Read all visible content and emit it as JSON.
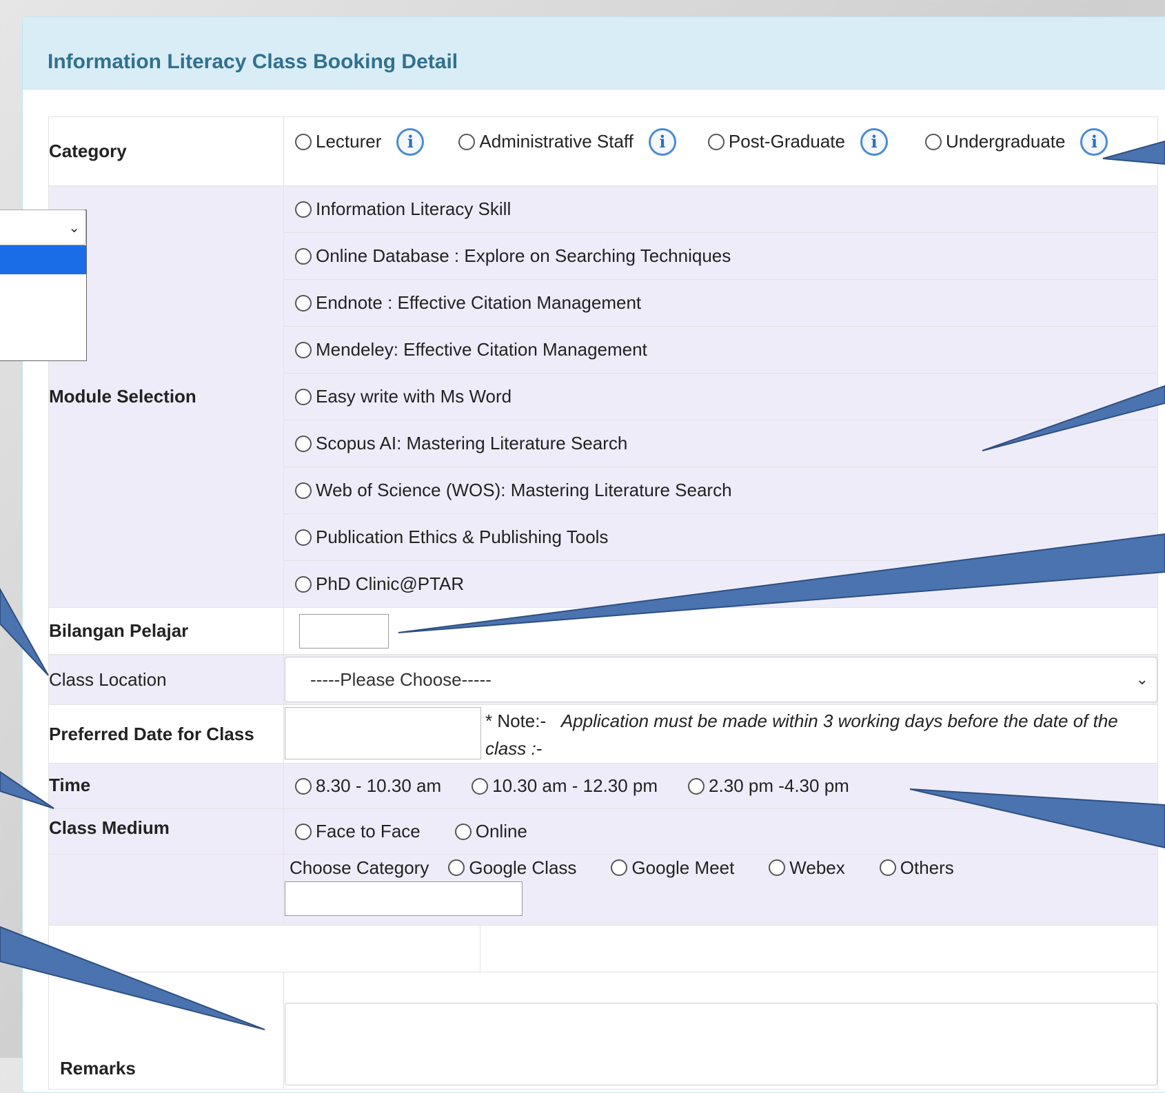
{
  "panel": {
    "title": "Information Literacy Class Booking Detail"
  },
  "category": {
    "label": "Category",
    "options": [
      "Lecturer",
      "Administrative Staff",
      "Post-Graduate",
      "Undergraduate"
    ],
    "info_icon": "info-icon"
  },
  "module": {
    "label": "Module Selection",
    "options": [
      "Information Literacy Skill",
      "Online Database : Explore on Searching Techniques",
      "Endnote : Effective Citation Management",
      "Mendeley: Effective Citation Management",
      "Easy write with Ms Word",
      "Scopus AI: Mastering Literature Search",
      "Web of Science (WOS): Mastering Literature Search",
      "Publication Ethics & Publishing Tools",
      "PhD Clinic@PTAR"
    ]
  },
  "students": {
    "label": "Bilangan Pelajar",
    "value": ""
  },
  "location": {
    "label": "Class Location",
    "selected": "-----Please Choose-----"
  },
  "date": {
    "label": "Preferred Date for Class",
    "value": "",
    "note_prefix": "* Note:-",
    "note_text": "Application must be made within 3 working days before the date of the class :-"
  },
  "time": {
    "label": "Time",
    "options": [
      "8.30 - 10.30 am",
      "10.30 am - 12.30 pm",
      "2.30 pm -4.30 pm"
    ]
  },
  "medium": {
    "label": "Class Medium",
    "options": [
      "Face to Face",
      "Online"
    ],
    "choose_label": "Choose Category",
    "platforms": [
      "Google Class",
      "Google Meet",
      "Webex",
      "Others"
    ],
    "other_value": ""
  },
  "remarks": {
    "label": "Remarks",
    "value": ""
  },
  "colors": {
    "heading_bg": "#d9edf7",
    "heading_text": "#31708f",
    "alt_row": "#efecf9",
    "callout": "#4a73b0",
    "dropdown_highlight": "#1a6de6"
  }
}
